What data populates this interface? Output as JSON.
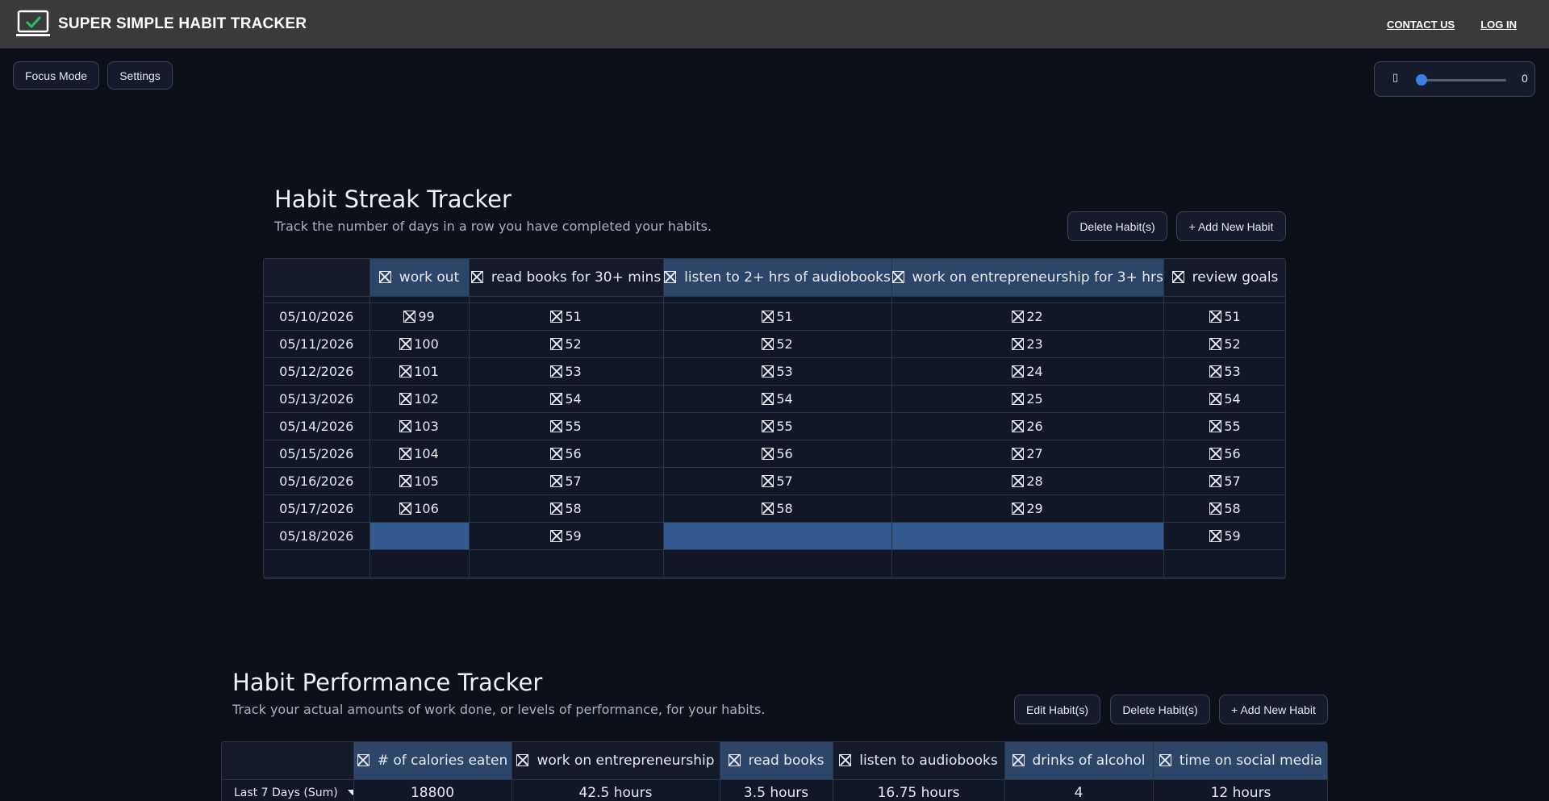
{
  "header": {
    "brand_bold": "SUPER SIMPLE",
    "brand_rest": "HABIT TRACKER",
    "nav": [
      "CONTACT US",
      "LOG IN"
    ]
  },
  "toolbar": {
    "focus_mode": "Focus Mode",
    "settings": "Settings",
    "slider_glyph": "▯",
    "slider_value": "0"
  },
  "streak": {
    "title": "Habit Streak Tracker",
    "subtitle": "Track the number of days in a row you have completed your habits.",
    "delete_label": "Delete Habit(s)",
    "add_label": "+ Add New Habit",
    "columns": [
      "work out",
      "read books for 30+ mins",
      "listen to 2+ hrs of audiobooks",
      "work on entrepreneurship for 3+ hrs",
      "review goals"
    ],
    "highlighted_columns": [
      0,
      2,
      3
    ],
    "rows": [
      {
        "date": "05/10/2026",
        "values": [
          "99",
          "51",
          "51",
          "22",
          "51"
        ]
      },
      {
        "date": "05/11/2026",
        "values": [
          "100",
          "52",
          "52",
          "23",
          "52"
        ]
      },
      {
        "date": "05/12/2026",
        "values": [
          "101",
          "53",
          "53",
          "24",
          "53"
        ]
      },
      {
        "date": "05/13/2026",
        "values": [
          "102",
          "54",
          "54",
          "25",
          "54"
        ]
      },
      {
        "date": "05/14/2026",
        "values": [
          "103",
          "55",
          "55",
          "26",
          "55"
        ]
      },
      {
        "date": "05/15/2026",
        "values": [
          "104",
          "56",
          "56",
          "27",
          "56"
        ]
      },
      {
        "date": "05/16/2026",
        "values": [
          "105",
          "57",
          "57",
          "28",
          "57"
        ]
      },
      {
        "date": "05/17/2026",
        "values": [
          "106",
          "58",
          "58",
          "29",
          "58"
        ]
      },
      {
        "date": "05/18/2026",
        "values": [
          "",
          "59",
          "",
          "",
          "59"
        ]
      }
    ]
  },
  "performance": {
    "title": "Habit Performance Tracker",
    "subtitle": "Track your actual amounts of work done, or levels of performance, for your habits.",
    "edit_label": "Edit Habit(s)",
    "delete_label": "Delete Habit(s)",
    "add_label": "+ Add New Habit",
    "columns": [
      "# of calories eaten",
      "work on entrepreneurship",
      "read books",
      "listen to audiobooks",
      "drinks of alcohol",
      "time on social media"
    ],
    "highlighted_columns": [
      0,
      2,
      4,
      5
    ],
    "filter_label": "Last 7 Days (Sum)",
    "summary": [
      "18800",
      "42.5 hours",
      "3.5 hours",
      "16.75 hours",
      "4",
      "12 hours"
    ]
  },
  "colors": {
    "background": "#0b1019",
    "topbar": "#3a3a3a",
    "header_highlight": "#2d4568",
    "selected_cell": "#345b8f",
    "brand_check": "#22c55e"
  }
}
